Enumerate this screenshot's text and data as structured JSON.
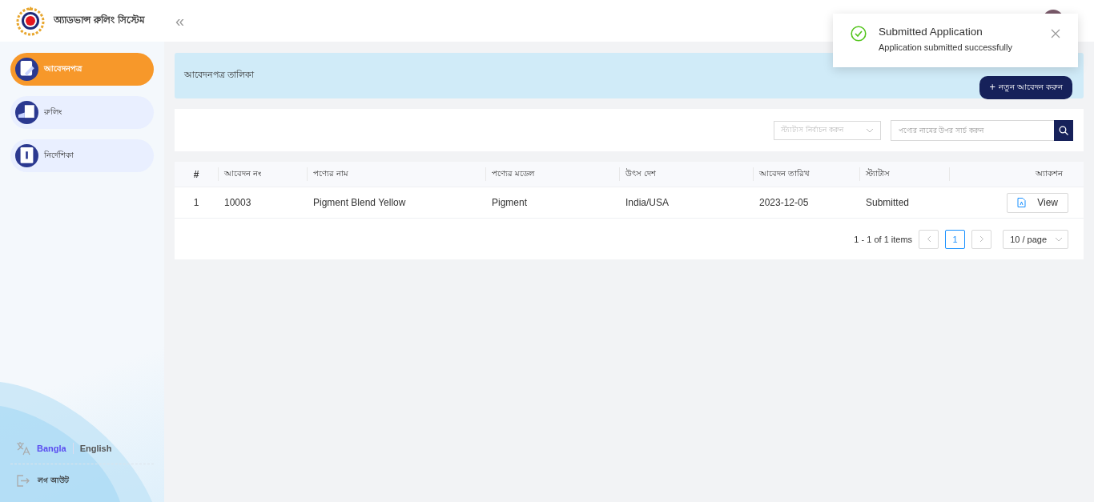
{
  "header": {
    "app_title": "অ্যাডভান্স রুলিং সিস্টেম",
    "collapse_icon": "«"
  },
  "sidebar": {
    "items": [
      {
        "label": "আবেদনপত্র",
        "selected": true
      },
      {
        "label": "রুলিং",
        "selected": false
      },
      {
        "label": "নির্দেশিকা",
        "selected": false
      }
    ],
    "languages": [
      {
        "label": "Bangla",
        "selected": true
      },
      {
        "label": "English",
        "selected": false
      }
    ],
    "logout": "লগ আউট"
  },
  "page_header": {
    "title": "আবেদনপত্র তালিকা",
    "new_button": "+ নতুন আবেদন করুন"
  },
  "filters": {
    "status_select": {
      "placeholder": "স্ট্যাটাস নির্বাচন করুন"
    },
    "search": {
      "placeholder": "পণ্যের নামের উপর সার্চ করুন"
    }
  },
  "table": {
    "columns": [
      "#",
      "আবেদন নং",
      "পণ্যের নাম",
      "পণ্যের মডেল",
      "উৎস দেশ",
      "আবেদন তারিখ",
      "স্ট্যাটাস",
      "অ্যাকশন"
    ],
    "rows": [
      {
        "index": "1",
        "application_no": "10003",
        "product_name": "Pigment Blend Yellow",
        "product_model": "Pigment",
        "origin_country": "India/USA",
        "date": "2023-12-05",
        "status": "Submitted",
        "action": "View"
      }
    ]
  },
  "pagination": {
    "summary": "1 - 1 of 1 items",
    "pages": [
      {
        "label": "1",
        "selected": true
      }
    ],
    "page_size": "10 / page"
  },
  "toast": {
    "title": "Submitted Application",
    "message": "Application submitted successfully"
  }
}
